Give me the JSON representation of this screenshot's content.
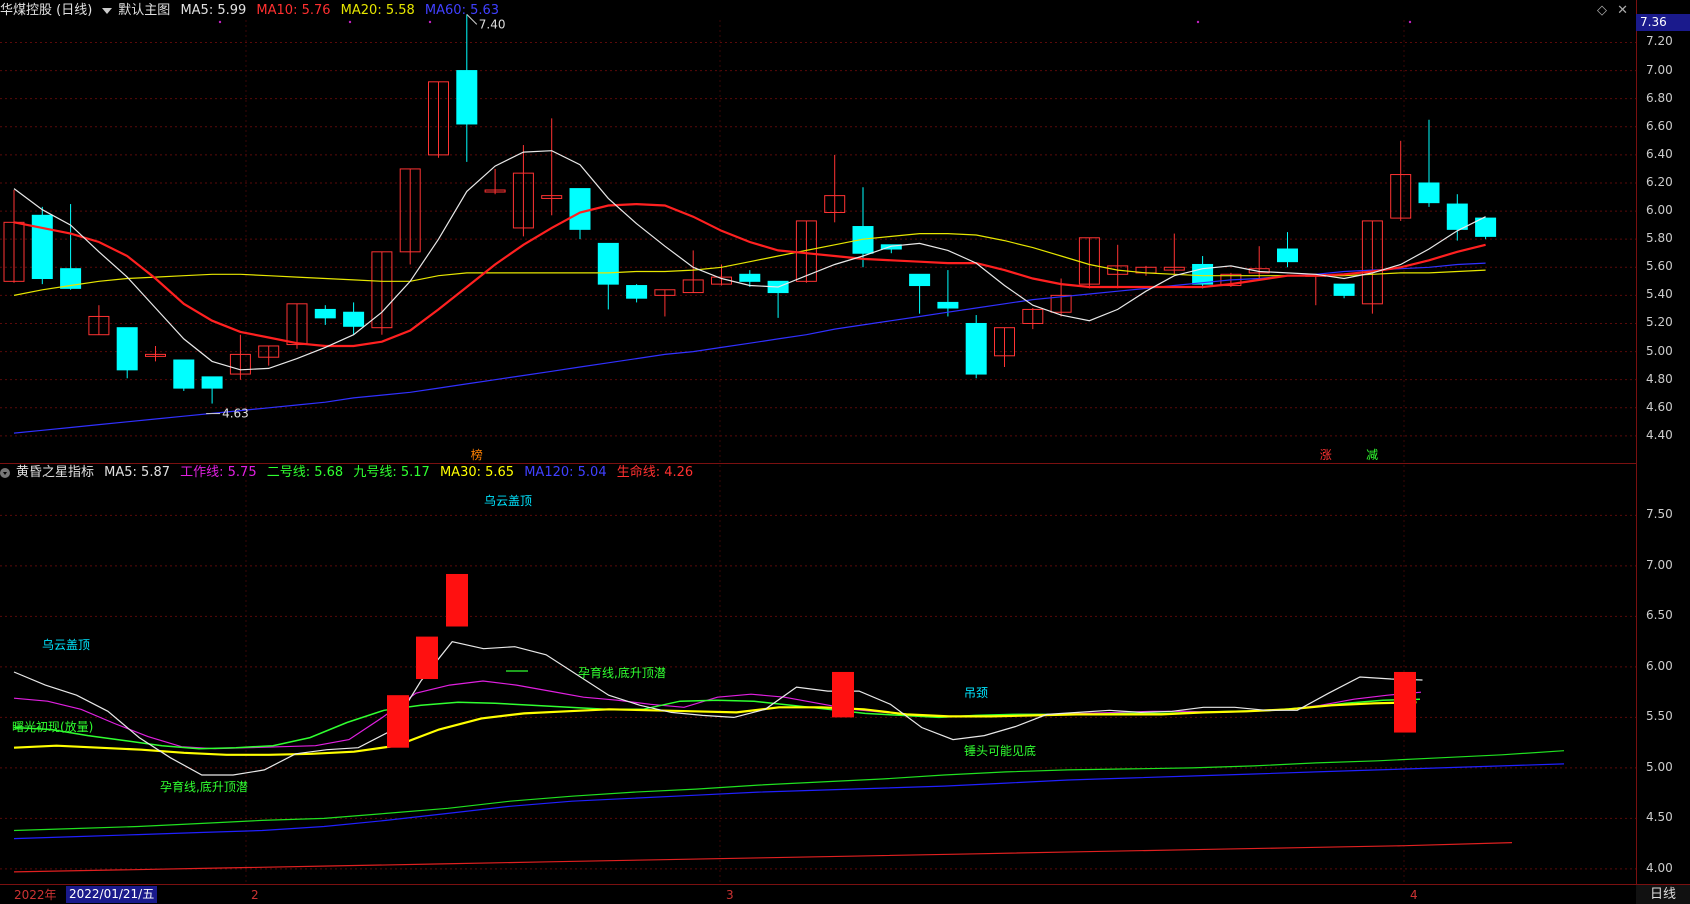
{
  "main_header": {
    "stock_name": "华煤控股 (日线)",
    "chart_name": "默认主图",
    "ma5": "MA5: 5.99",
    "ma10": "MA10: 5.76",
    "ma20": "MA20: 5.58",
    "ma60": "MA60: 5.63"
  },
  "sub_header": {
    "indicator_name": "黄昏之星指标",
    "ma5": "MA5: 5.87",
    "work": "工作线: 5.75",
    "line2": "二号线: 5.68",
    "line9": "九号线: 5.17",
    "ma30": "MA30: 5.65",
    "ma120": "MA120: 5.04",
    "life": "生命线: 4.26"
  },
  "colors": {
    "up": "#ff3333",
    "down": "#00ffff",
    "ma5": "#e8e8e8",
    "ma10": "#ff2020",
    "ma20": "#e6e600",
    "ma60": "#3030ff",
    "work": "#e020e0",
    "line2": "#30ff30",
    "ma30": "#ffff00",
    "grid": "#5a0a0a"
  },
  "current_price": "7.36",
  "right_axis_top": [
    "7.20",
    "7.00",
    "6.80",
    "6.60",
    "6.40",
    "6.20",
    "6.00",
    "5.80",
    "5.60",
    "5.40",
    "5.20",
    "5.00",
    "4.80",
    "4.60",
    "4.40"
  ],
  "right_axis_bottom": [
    "7.50",
    "7.00",
    "6.50",
    "6.00",
    "5.50",
    "5.00",
    "4.50",
    "4.00"
  ],
  "bottom_axis": {
    "year": "2022年",
    "date": "2022/01/21/五",
    "m2": "2",
    "m3": "3",
    "m4": "4"
  },
  "period_button": "日线",
  "annotations": {
    "high": "7.40",
    "low": "4.63",
    "bang": "榜",
    "zhang": "涨",
    "jian": "减"
  },
  "signals": [
    {
      "text": "乌云盖顶",
      "color": "#00e5ff"
    },
    {
      "text": "乌云盖顶",
      "color": "#00e5ff"
    },
    {
      "text": "曙光初现(放量)",
      "color": "#30ff30"
    },
    {
      "text": "孕育线,底升顶潜",
      "color": "#30ff30"
    },
    {
      "text": "孕育线,底升顶潜",
      "color": "#30ff30"
    },
    {
      "text": "吊颈",
      "color": "#00e5ff"
    },
    {
      "text": "锤头可能见底",
      "color": "#30ff30"
    }
  ],
  "chart_data": [
    {
      "type": "candlestick",
      "series_names": [
        "MA5",
        "MA10",
        "MA20",
        "MA60"
      ],
      "ohlc": [
        [
          5.5,
          5.92,
          5.49,
          6.15
        ],
        [
          5.97,
          5.52,
          5.48,
          6.03
        ],
        [
          5.59,
          5.45,
          5.44,
          6.05
        ],
        [
          5.12,
          5.25,
          5.12,
          5.33
        ],
        [
          5.17,
          4.87,
          4.81,
          5.17
        ],
        [
          4.98,
          4.98,
          4.93,
          5.04
        ],
        [
          4.94,
          4.74,
          4.72,
          4.94
        ],
        [
          4.82,
          4.74,
          4.63,
          4.82
        ],
        [
          4.84,
          4.98,
          4.8,
          5.12
        ],
        [
          4.96,
          5.04,
          4.9,
          5.04
        ],
        [
          5.05,
          5.34,
          5.02,
          5.34
        ],
        [
          5.3,
          5.24,
          5.19,
          5.33
        ],
        [
          5.28,
          5.18,
          5.12,
          5.35
        ],
        [
          5.17,
          5.71,
          5.12,
          5.71
        ],
        [
          5.71,
          6.3,
          5.62,
          6.3
        ],
        [
          6.4,
          6.92,
          6.38,
          6.92
        ],
        [
          7.0,
          6.62,
          6.35,
          7.4
        ],
        [
          6.15,
          6.15,
          6.12,
          6.3
        ],
        [
          5.88,
          6.27,
          5.82,
          6.47
        ],
        [
          6.09,
          6.11,
          5.97,
          6.66
        ],
        [
          6.16,
          5.87,
          5.8,
          6.16
        ],
        [
          5.77,
          5.48,
          5.3,
          5.77
        ],
        [
          5.47,
          5.38,
          5.35,
          5.48
        ],
        [
          5.4,
          5.44,
          5.25,
          5.44
        ],
        [
          5.42,
          5.51,
          5.42,
          5.72
        ],
        [
          5.48,
          5.53,
          5.47,
          5.62
        ],
        [
          5.55,
          5.5,
          5.46,
          5.58
        ],
        [
          5.5,
          5.42,
          5.24,
          5.5
        ],
        [
          5.5,
          5.93,
          5.49,
          5.93
        ],
        [
          5.99,
          6.11,
          5.92,
          6.4
        ],
        [
          5.89,
          5.7,
          5.6,
          6.17
        ],
        [
          5.76,
          5.73,
          5.7,
          5.76
        ],
        [
          5.55,
          5.47,
          5.27,
          5.55
        ],
        [
          5.35,
          5.31,
          5.25,
          5.58
        ],
        [
          5.2,
          4.84,
          4.81,
          5.26
        ],
        [
          4.97,
          5.17,
          4.89,
          5.17
        ],
        [
          5.2,
          5.3,
          5.16,
          5.31
        ],
        [
          5.28,
          5.4,
          5.25,
          5.52
        ],
        [
          5.48,
          5.81,
          5.45,
          5.81
        ],
        [
          5.55,
          5.61,
          5.45,
          5.76
        ],
        [
          5.56,
          5.6,
          5.54,
          5.61
        ],
        [
          5.58,
          5.6,
          5.55,
          5.84
        ],
        [
          5.62,
          5.48,
          5.45,
          5.68
        ],
        [
          5.47,
          5.55,
          5.46,
          5.56
        ],
        [
          5.56,
          5.59,
          5.51,
          5.75
        ],
        [
          5.73,
          5.64,
          5.6,
          5.85
        ],
        [
          5.55,
          5.55,
          5.33,
          5.55
        ],
        [
          5.48,
          5.4,
          5.38,
          5.48
        ],
        [
          5.34,
          5.93,
          5.27,
          5.93
        ],
        [
          5.95,
          6.26,
          5.93,
          6.5
        ],
        [
          6.2,
          6.06,
          6.03,
          6.65
        ],
        [
          6.05,
          5.87,
          5.79,
          6.12
        ],
        [
          5.95,
          5.82,
          5.8,
          5.95
        ]
      ],
      "ma5": [
        6.16,
        6.01,
        5.9,
        5.71,
        5.53,
        5.31,
        5.09,
        4.93,
        4.87,
        4.88,
        4.95,
        5.03,
        5.12,
        5.28,
        5.5,
        5.8,
        6.14,
        6.32,
        6.42,
        6.43,
        6.33,
        6.09,
        5.91,
        5.75,
        5.6,
        5.52,
        5.47,
        5.46,
        5.54,
        5.62,
        5.68,
        5.75,
        5.77,
        5.72,
        5.63,
        5.47,
        5.33,
        5.26,
        5.22,
        5.3,
        5.43,
        5.54,
        5.59,
        5.61,
        5.57,
        5.56,
        5.55,
        5.52,
        5.56,
        5.62,
        5.73,
        5.86,
        5.96
      ],
      "ma10": [
        5.92,
        5.88,
        5.84,
        5.78,
        5.68,
        5.52,
        5.34,
        5.22,
        5.14,
        5.1,
        5.06,
        5.04,
        5.04,
        5.07,
        5.15,
        5.3,
        5.46,
        5.62,
        5.76,
        5.88,
        5.99,
        6.04,
        6.05,
        6.04,
        5.96,
        5.86,
        5.78,
        5.72,
        5.7,
        5.68,
        5.66,
        5.65,
        5.64,
        5.63,
        5.63,
        5.58,
        5.52,
        5.48,
        5.46,
        5.46,
        5.46,
        5.46,
        5.46,
        5.48,
        5.51,
        5.54,
        5.54,
        5.55,
        5.57,
        5.6,
        5.65,
        5.71,
        5.76
      ],
      "ma20": [
        5.4,
        5.44,
        5.47,
        5.5,
        5.52,
        5.53,
        5.54,
        5.55,
        5.55,
        5.54,
        5.53,
        5.52,
        5.51,
        5.5,
        5.5,
        5.54,
        5.56,
        5.56,
        5.56,
        5.56,
        5.56,
        5.56,
        5.57,
        5.57,
        5.58,
        5.6,
        5.64,
        5.68,
        5.72,
        5.76,
        5.8,
        5.82,
        5.84,
        5.84,
        5.83,
        5.79,
        5.74,
        5.68,
        5.62,
        5.58,
        5.56,
        5.55,
        5.54,
        5.54,
        5.54,
        5.54,
        5.54,
        5.54,
        5.55,
        5.56,
        5.56,
        5.57,
        5.58
      ],
      "ma60": [
        4.42,
        4.44,
        4.46,
        4.48,
        4.5,
        4.52,
        4.54,
        4.56,
        4.58,
        4.6,
        4.62,
        4.64,
        4.67,
        4.69,
        4.71,
        4.74,
        4.77,
        4.8,
        4.83,
        4.86,
        4.89,
        4.92,
        4.95,
        4.98,
        5.0,
        5.03,
        5.06,
        5.09,
        5.12,
        5.16,
        5.19,
        5.22,
        5.25,
        5.28,
        5.31,
        5.34,
        5.37,
        5.39,
        5.41,
        5.43,
        5.45,
        5.47,
        5.49,
        5.51,
        5.52,
        5.54,
        5.55,
        5.57,
        5.58,
        5.59,
        5.6,
        5.62,
        5.63
      ]
    },
    {
      "type": "line",
      "series_names": [
        "MA5",
        "工作线",
        "二号线",
        "九号线",
        "MA30",
        "MA120",
        "生命线"
      ],
      "ma5": [
        5.95,
        5.82,
        5.72,
        5.56,
        5.3,
        5.1,
        4.93,
        4.93,
        4.98,
        5.14,
        5.18,
        5.2,
        5.36,
        5.86,
        6.25,
        6.18,
        6.2,
        6.12,
        5.92,
        5.72,
        5.62,
        5.55,
        5.52,
        5.5,
        5.58,
        5.8,
        5.76,
        5.76,
        5.63,
        5.4,
        5.28,
        5.32,
        5.41,
        5.53,
        5.55,
        5.57,
        5.55,
        5.56,
        5.6,
        5.6,
        5.57,
        5.57,
        5.74,
        5.9,
        5.88,
        5.87
      ],
      "work": [
        5.69,
        5.66,
        5.58,
        5.44,
        5.31,
        5.21,
        5.19,
        5.2,
        5.21,
        5.22,
        5.28,
        5.5,
        5.74,
        5.82,
        5.86,
        5.82,
        5.76,
        5.7,
        5.67,
        5.63,
        5.6,
        5.7,
        5.73,
        5.7,
        5.64,
        5.58,
        5.55,
        5.52,
        5.51,
        5.52,
        5.53,
        5.53,
        5.54,
        5.55,
        5.56,
        5.56,
        5.55,
        5.56,
        5.58,
        5.62,
        5.68,
        5.72,
        5.75
      ],
      "line2": [
        5.4,
        5.38,
        5.32,
        5.27,
        5.22,
        5.19,
        5.2,
        5.22,
        5.3,
        5.45,
        5.57,
        5.62,
        5.65,
        5.64,
        5.62,
        5.6,
        5.58,
        5.58,
        5.66,
        5.67,
        5.66,
        5.62,
        5.58,
        5.54,
        5.52,
        5.5,
        5.52,
        5.53,
        5.53,
        5.53,
        5.54,
        5.54,
        5.55,
        5.56,
        5.57,
        5.6,
        5.64,
        5.67,
        5.68
      ],
      "line9": [
        4.38,
        4.4,
        4.42,
        4.45,
        4.48,
        4.5,
        4.55,
        4.6,
        4.67,
        4.72,
        4.76,
        4.79,
        4.83,
        4.86,
        4.89,
        4.93,
        4.96,
        4.98,
        4.99,
        5.0,
        5.02,
        5.05,
        5.07,
        5.1,
        5.13,
        5.17
      ],
      "ma30": [
        5.2,
        5.22,
        5.2,
        5.18,
        5.15,
        5.13,
        5.13,
        5.14,
        5.16,
        5.22,
        5.38,
        5.49,
        5.54,
        5.56,
        5.58,
        5.57,
        5.56,
        5.55,
        5.6,
        5.6,
        5.58,
        5.53,
        5.51,
        5.51,
        5.52,
        5.53,
        5.53,
        5.53,
        5.55,
        5.56,
        5.58,
        5.62,
        5.64,
        5.65
      ],
      "ma120": [
        4.3,
        4.32,
        4.34,
        4.36,
        4.38,
        4.42,
        4.48,
        4.55,
        4.62,
        4.67,
        4.7,
        4.73,
        4.76,
        4.78,
        4.8,
        4.82,
        4.85,
        4.88,
        4.9,
        4.92,
        4.94,
        4.96,
        4.98,
        5.0,
        5.02,
        5.04
      ],
      "life": [
        3.97,
        3.99,
        4.01,
        4.03,
        4.05,
        4.07,
        4.09,
        4.11,
        4.13,
        4.15,
        4.17,
        4.19,
        4.21,
        4.23,
        4.26
      ],
      "signal_bars": [
        [
          5.2,
          5.72
        ],
        [
          5.88,
          6.3
        ],
        [
          6.4,
          6.92
        ],
        [
          5.5,
          5.95
        ],
        [
          5.35,
          5.95
        ]
      ]
    }
  ]
}
